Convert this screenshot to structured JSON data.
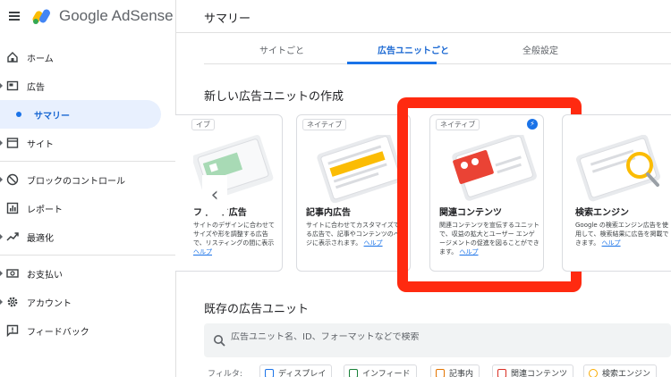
{
  "app": {
    "brand": "Google AdSense"
  },
  "header": {
    "title": "サマリー"
  },
  "sidebar": {
    "items": [
      {
        "label": "ホーム",
        "icon": "home-icon"
      },
      {
        "label": "広告",
        "icon": "ad-icon"
      },
      {
        "label": "サマリー",
        "active": true
      },
      {
        "label": "サイト",
        "icon": "browser-icon"
      },
      {
        "label": "ブロックのコントロール",
        "icon": "block-icon"
      },
      {
        "label": "レポート",
        "icon": "report-icon"
      },
      {
        "label": "最適化",
        "icon": "trending-icon"
      },
      {
        "label": "お支払い",
        "icon": "payment-icon"
      },
      {
        "label": "アカウント",
        "icon": "gear-icon"
      },
      {
        "label": "フィードバック",
        "icon": "feedback-icon"
      }
    ]
  },
  "tabs": [
    {
      "label": "サイトごと"
    },
    {
      "label": "広告ユニットごと",
      "active": true
    },
    {
      "label": "全般設定"
    }
  ],
  "create_section": {
    "title": "新しい広告ユニットの作成",
    "cards": [
      {
        "tag": "イブ",
        "title": "フィード広告",
        "desc": "サイトのデザインに合わせてサイズや形を調整する広告で、リスティングの間に表示",
        "link": "ヘルプ"
      },
      {
        "tag": "ネイティブ",
        "title": "記事内広告",
        "desc": "サイトに合わせてカスタマイズできる広告で、記事やコンテンツのページに表示されます。",
        "link": "ヘルプ"
      },
      {
        "tag": "ネイティブ",
        "title": "関連コンテンツ",
        "desc": "関連コンテンツを宣伝するユニットで、収益の拡大とユーザー エンゲージメントの促進を図ることができます。",
        "link": "ヘルプ"
      },
      {
        "tag": "",
        "title": "検索エンジン",
        "desc": "Google の検索エンジン広告を使用して、検索結果に広告を掲載できます。",
        "link": "ヘルプ"
      }
    ]
  },
  "existing_section": {
    "title": "既存の広告ユニット",
    "search_placeholder": "広告ユニット名、ID、フォーマットなどで検索",
    "filter_label": "フィルタ:",
    "filters": [
      {
        "label": "ディスプレイ",
        "color": "#1a73e8"
      },
      {
        "label": "インフィード",
        "color": "#188038"
      },
      {
        "label": "記事内",
        "color": "#e37400"
      },
      {
        "label": "関連コンテンツ",
        "color": "#d93025"
      },
      {
        "label": "検索エンジン",
        "color": "#f9ab00"
      }
    ]
  },
  "colors": {
    "accent": "#1a73e8",
    "highlight_frame": "#ff2a10"
  }
}
